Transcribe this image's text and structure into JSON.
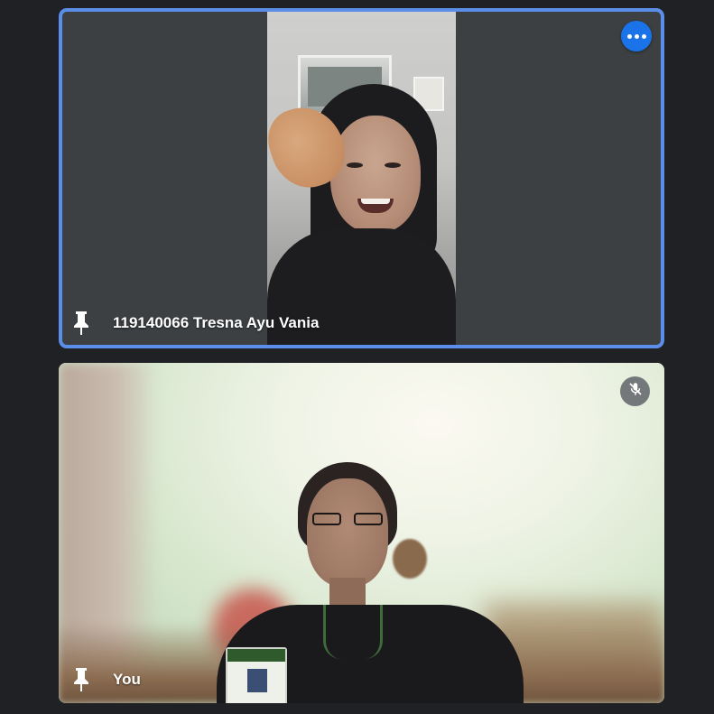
{
  "participants": [
    {
      "name": "119140066 Tresna Ayu Vania",
      "pinned_icon": "pin-icon",
      "menu_icon": "more-options-icon",
      "highlight_color": "#5b8ee8",
      "menu_button_color": "#1a73e8"
    },
    {
      "name": "You",
      "pinned_icon": "pin-icon",
      "status_icon": "mic-off-icon"
    }
  ],
  "theme": {
    "background": "#202124",
    "tile_background": "#3c4043"
  }
}
